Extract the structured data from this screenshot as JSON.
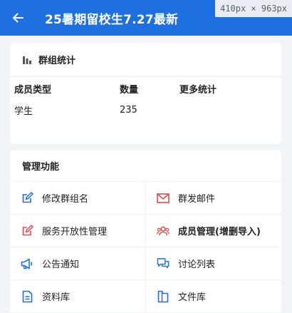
{
  "header": {
    "title": "25暑期留校生7.27最新",
    "size_badge": "410px × 963px"
  },
  "stats": {
    "title": "群组统计",
    "columns": [
      "成员类型",
      "数量",
      "更多统计"
    ],
    "rows": [
      {
        "type": "学生",
        "count": "235",
        "more": ""
      }
    ]
  },
  "functions": {
    "title": "管理功能",
    "items": [
      {
        "label": "修改群组名",
        "icon": "edit-icon",
        "color": "#1e6fe0"
      },
      {
        "label": "群发邮件",
        "icon": "mail-icon",
        "color": "#e5484d"
      },
      {
        "label": "服务开放性管理",
        "icon": "edit-icon",
        "color": "#e5484d"
      },
      {
        "label": "成员管理(增删导入)",
        "icon": "members-icon",
        "color": "#e5484d"
      },
      {
        "label": "公告通知",
        "icon": "megaphone-icon",
        "color": "#1e6fe0"
      },
      {
        "label": "讨论列表",
        "icon": "chat-icon",
        "color": "#1e6fe0"
      },
      {
        "label": "资料库",
        "icon": "document-icon",
        "color": "#1e6fe0"
      },
      {
        "label": "文件库",
        "icon": "folder-icon",
        "color": "#1e6fe0"
      }
    ]
  }
}
